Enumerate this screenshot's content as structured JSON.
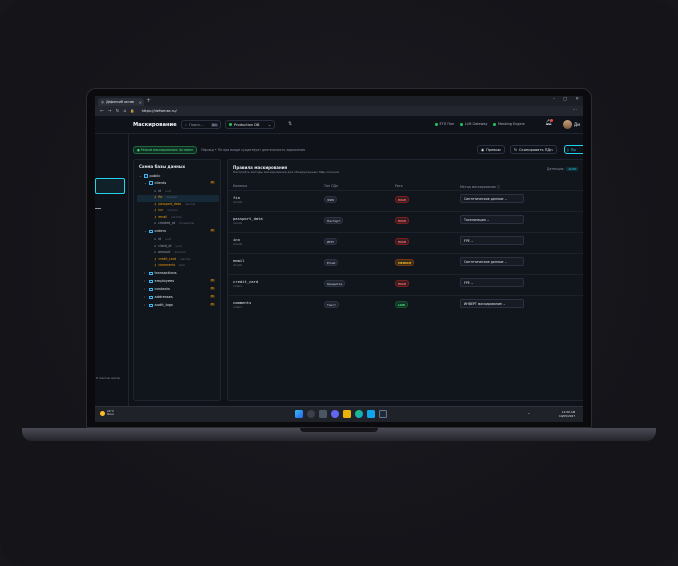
{
  "colors": {
    "accent": "#22d3ee",
    "ok": "#22c55e",
    "high": "#ef4444",
    "medium": "#f59e0b"
  },
  "browser": {
    "tab_title": "Дефенсиб актив",
    "url": "https://defsense.ru/"
  },
  "appbar": {
    "title": "Маскирование",
    "search_placeholder": "Поиск...",
    "search_shortcut": "⌘K",
    "db_name": "Production DB",
    "status": [
      "ЕТЛ Поп",
      "LLM Gateway",
      "Masking Engine"
    ],
    "user_name": "Дм"
  },
  "mode": {
    "badge": "Режим маскирования: Активен",
    "hint": "Период • Пн при входе существует деятельность заражения"
  },
  "actions": {
    "preview": "Превью",
    "scan": "Сканировать ПДн",
    "apply": "Пр"
  },
  "leftnav": {
    "footer": "Л пактнк ветек"
  },
  "schema": {
    "title": "Схема базы данных",
    "root": "public",
    "tables": [
      {
        "name": "clients",
        "pii": "PII",
        "expanded": true,
        "columns": [
          {
            "name": "id",
            "type": "uuid"
          },
          {
            "name": "fio",
            "type": "varchar",
            "key": true
          },
          {
            "name": "passport_data",
            "type": "varchar",
            "key": true
          },
          {
            "name": "inn",
            "type": "varchar",
            "key": true
          },
          {
            "name": "email",
            "type": "varchar",
            "key": true
          },
          {
            "name": "created_at",
            "type": "timestamp"
          }
        ]
      },
      {
        "name": "orders",
        "pii": "PII",
        "expanded": true,
        "columns": [
          {
            "name": "id",
            "type": "uuid"
          },
          {
            "name": "client_id",
            "type": "uuid"
          },
          {
            "name": "amount",
            "type": "decimal"
          },
          {
            "name": "credit_card",
            "type": "varchar",
            "key": true
          },
          {
            "name": "comments",
            "type": "text",
            "key": true
          }
        ]
      },
      {
        "name": "transactions",
        "pii": ""
      },
      {
        "name": "employees",
        "pii": "PII"
      },
      {
        "name": "contacts",
        "pii": "PII"
      },
      {
        "name": "addresses",
        "pii": "PII"
      },
      {
        "name": "audit_logs",
        "pii": "PII"
      }
    ]
  },
  "rules": {
    "title": "Правила маскирования",
    "subtitle": "Настройте методы маскирования для обнаруженных ПДн колонок",
    "detect_label": "Детекция:",
    "detect_value": "AUTO",
    "headers": {
      "column": "Колонка",
      "type": "Тип ПДн",
      "risk": "Риск",
      "method": "Метод маскирования ⓘ"
    },
    "rows": [
      {
        "column": "fio",
        "table": "clients",
        "type": "ФИО",
        "risk": "HIGH",
        "level": "high",
        "method": "Синтетические данные"
      },
      {
        "column": "passport_data",
        "table": "clients",
        "type": "Паспорт",
        "risk": "HIGH",
        "level": "high",
        "method": "Токенизация"
      },
      {
        "column": "inn",
        "table": "clients",
        "type": "ИНН",
        "risk": "HIGH",
        "level": "high",
        "method": "FPE"
      },
      {
        "column": "email",
        "table": "clients",
        "type": "Email",
        "risk": "MEDIUM",
        "level": "med",
        "method": "Синтетические данные"
      },
      {
        "column": "credit_card",
        "table": "orders",
        "type": "Кредитка",
        "risk": "HIGH",
        "level": "high",
        "method": "FPE"
      },
      {
        "column": "comments",
        "table": "orders",
        "type": "Текст",
        "risk": "LOW",
        "level": "low",
        "method": "ИНВЕРТ маскирование"
      }
    ]
  },
  "taskbar": {
    "temp": "24°C",
    "weather": "Ясно",
    "time": "11:00 AM",
    "date": "10/05/2027"
  }
}
